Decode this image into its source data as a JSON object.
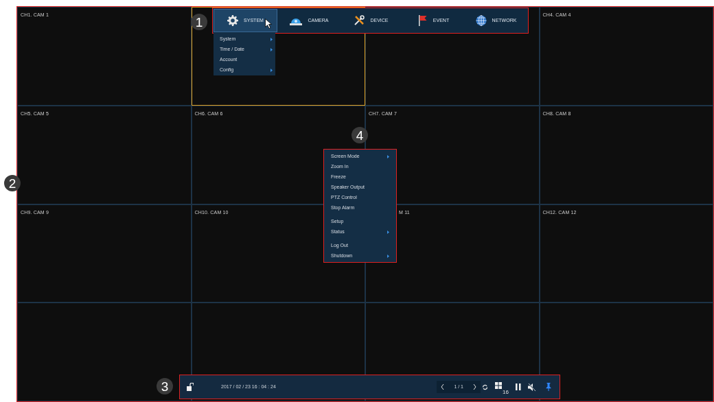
{
  "cells": [
    {
      "label": "CH1. CAM 1",
      "selected": false
    },
    {
      "selected": true
    },
    {
      "selected": false
    },
    {
      "label": "CH4. CAM 4",
      "selected": false
    },
    {
      "label": "CH5. CAM 5",
      "selected": false
    },
    {
      "label": "CH6. CAM 6",
      "selected": false
    },
    {
      "label": "CH7. CAM 7",
      "selected": false
    },
    {
      "label": "CH8. CAM 8",
      "selected": false
    },
    {
      "label": "CH9. CAM 9",
      "selected": false
    },
    {
      "label": "CH10. CAM 10",
      "selected": false
    },
    {
      "label": "M 11",
      "selected": false
    },
    {
      "label": "CH12. CAM 12",
      "selected": false
    },
    {
      "selected": false
    },
    {
      "selected": false
    },
    {
      "selected": false
    },
    {
      "selected": false
    }
  ],
  "main_menu": {
    "tabs": [
      {
        "kind": "gear",
        "label": "SYSTEM",
        "selected": true
      },
      {
        "kind": "camera",
        "label": "CAMERA",
        "selected": false
      },
      {
        "kind": "tools",
        "label": "DEVICE",
        "selected": false
      },
      {
        "kind": "flag",
        "label": "EVENT",
        "selected": false
      },
      {
        "kind": "globe",
        "label": "NETWORK",
        "selected": false
      }
    ],
    "submenu": [
      {
        "label": "System",
        "has_submenu": true
      },
      {
        "label": "Time / Date",
        "has_submenu": true
      },
      {
        "label": "Account",
        "has_submenu": false
      },
      {
        "label": "Config",
        "has_submenu": true
      }
    ]
  },
  "context_menu": {
    "groups": [
      {
        "items": [
          {
            "label": "Screen Mode",
            "has_submenu": true
          },
          {
            "label": "Zoom In",
            "has_submenu": false
          },
          {
            "label": "Freeze",
            "has_submenu": false
          },
          {
            "label": "Speaker Output",
            "has_submenu": false
          },
          {
            "label": "PTZ Control",
            "has_submenu": false
          },
          {
            "label": "Stop Alarm",
            "has_submenu": false
          }
        ]
      },
      {
        "items": [
          {
            "label": "Setup",
            "has_submenu": false
          },
          {
            "label": "Status",
            "has_submenu": true
          }
        ]
      },
      {
        "items": [
          {
            "label": "Log Out",
            "has_submenu": false
          },
          {
            "label": "Shutdown",
            "has_submenu": true
          }
        ]
      }
    ]
  },
  "status_bar": {
    "datetime": "2017 / 02 / 23 16 : 04 : 24",
    "page": "1 / 1",
    "layout_badge": "16"
  },
  "callouts": [
    "1",
    "2",
    "3",
    "4"
  ]
}
